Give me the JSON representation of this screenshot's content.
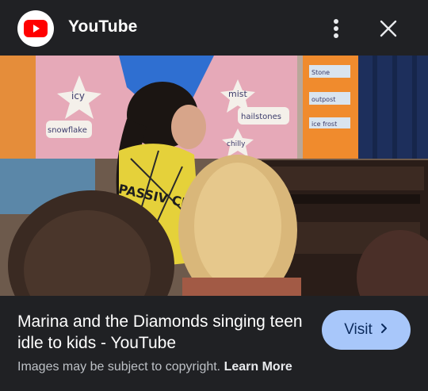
{
  "header": {
    "site_name": "YouTube",
    "logo_icon": "youtube-logo-icon",
    "menu_icon": "more-vert-icon",
    "close_icon": "close-icon"
  },
  "image": {
    "description_icon": "photo-content",
    "lens_icon": "google-lens-icon",
    "board_labels": [
      "icy",
      "snowflake",
      "mist",
      "hailstones",
      "chilly",
      "Stone",
      "outpost",
      "ice frost"
    ],
    "shirt_text": "PASSIV CHART"
  },
  "result": {
    "title": "Marina and the Diamonds singing teen idle to kids - YouTube",
    "visit_label": "Visit",
    "visit_icon": "chevron-right-icon",
    "copyright_text": "Images may be subject to copyright.",
    "learn_more_label": "Learn More"
  },
  "colors": {
    "background": "#202124",
    "visit_bg": "#a8c7fa",
    "youtube_red": "#ff0000"
  }
}
